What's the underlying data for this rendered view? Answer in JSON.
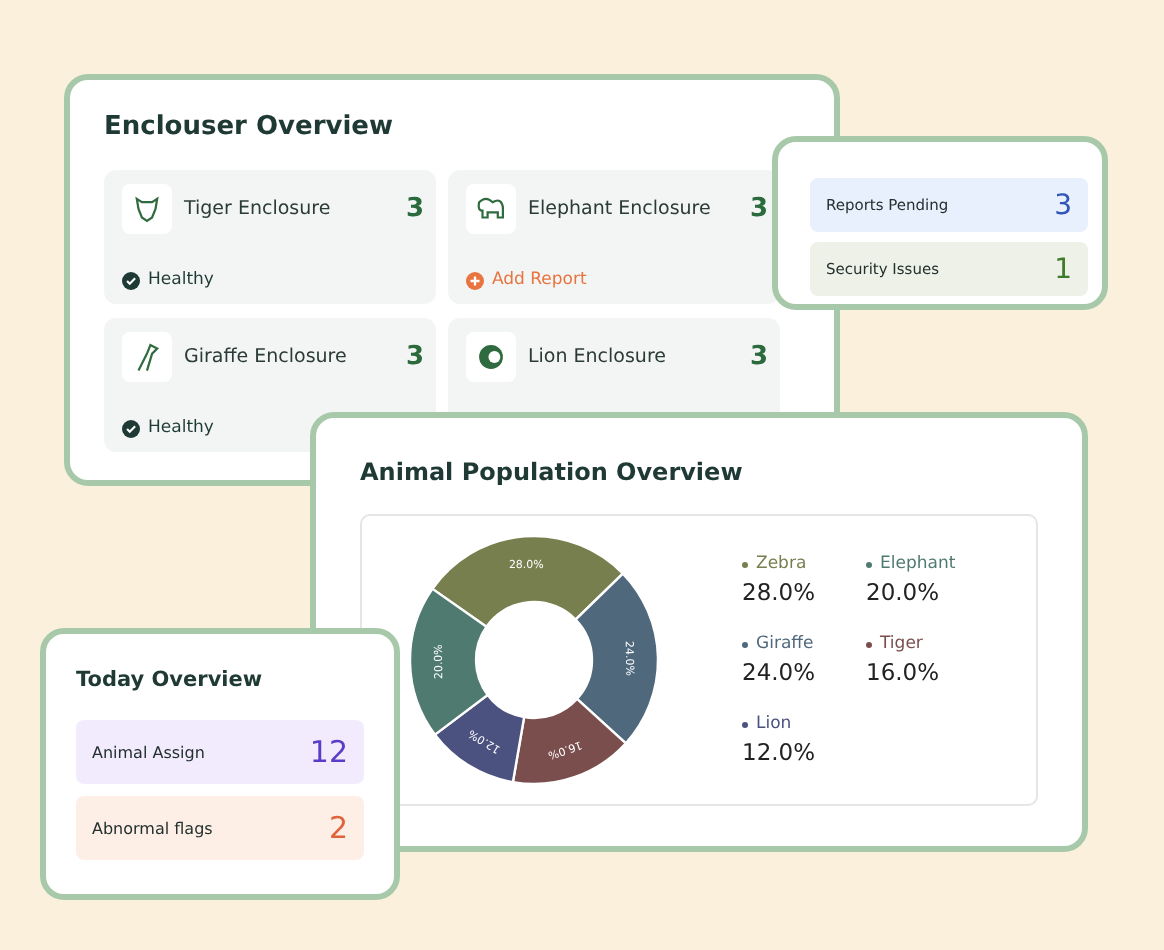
{
  "enclosure_overview": {
    "title": "Enclouser Overview",
    "enclosures": [
      {
        "name": "Tiger Enclosure",
        "count": "3",
        "status": {
          "kind": "healthy",
          "text": "Healthy"
        }
      },
      {
        "name": "Elephant Enclosure",
        "count": "3",
        "status": {
          "kind": "action",
          "text": "Add Report"
        }
      },
      {
        "name": "Giraffe Enclosure",
        "count": "3",
        "status": {
          "kind": "healthy",
          "text": "Healthy"
        }
      },
      {
        "name": "Lion Enclosure",
        "count": "3"
      }
    ]
  },
  "alerts": [
    {
      "label": "Reports Pending",
      "value": "3",
      "color": "#2f55b8"
    },
    {
      "label": "Security Issues",
      "value": "1",
      "color": "#3d7a2a"
    }
  ],
  "population": {
    "title": "Animal Population Overview",
    "chart_data": {
      "type": "donut",
      "categories": [
        "Zebra",
        "Giraffe",
        "Tiger",
        "Lion",
        "Elephant"
      ],
      "values": [
        28,
        24,
        16,
        12,
        20
      ],
      "value_labels": [
        "28.0%",
        "24.0%",
        "16.0%",
        "12.0%",
        "20.0%"
      ],
      "colors": [
        "#777f4e",
        "#4f687c",
        "#7b4e4e",
        "#4b5280",
        "#4f7a70"
      ]
    }
  },
  "today": {
    "title": "Today Overview",
    "items": [
      {
        "label": "Animal Assign",
        "value": "12",
        "color": "#5a3cc8"
      },
      {
        "label": "Abnormal flags",
        "value": "2",
        "color": "#e0643a"
      }
    ]
  }
}
